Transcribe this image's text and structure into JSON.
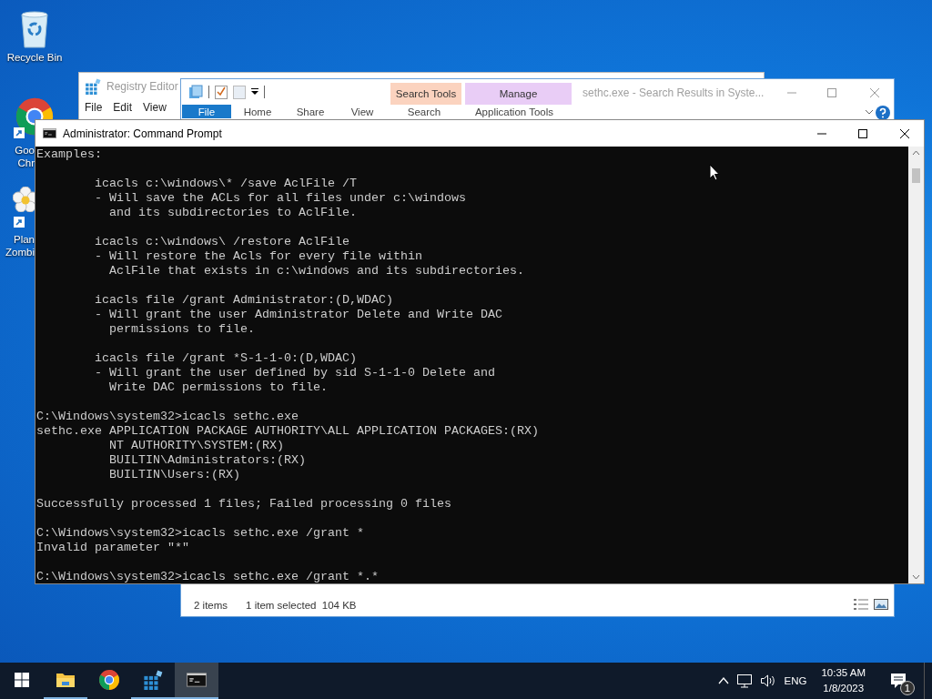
{
  "desktop_icons": [
    {
      "kind": "recycle-bin",
      "shortcut": false,
      "lines": [
        "Recycle Bin"
      ]
    },
    {
      "kind": "browser",
      "shortcut": true,
      "lines": [
        "Goo",
        "Chr"
      ]
    },
    {
      "kind": "flower",
      "shortcut": true,
      "lines": [
        "Plan",
        "Zombi"
      ]
    }
  ],
  "registry_editor": {
    "title": "Registry Editor",
    "menu": [
      "File",
      "Edit",
      "View"
    ]
  },
  "explorer": {
    "title": "sethc.exe - Search Results in Syste...",
    "context_groups": [
      {
        "label": "Search Tools",
        "color": "#fbd3bf"
      },
      {
        "label": "Manage",
        "color": "#e9cdf6"
      }
    ],
    "ribbon_tabs": [
      {
        "label": "File",
        "selected": true
      },
      {
        "label": "Home",
        "selected": false
      },
      {
        "label": "Share",
        "selected": false
      },
      {
        "label": "View",
        "selected": false
      },
      {
        "label": "Search",
        "selected": false
      },
      {
        "label": "Application Tools",
        "selected": false
      }
    ],
    "status": [
      "2 items",
      "1 item selected  104 KB"
    ]
  },
  "command_prompt": {
    "title": "Administrator: Command Prompt",
    "paragraphs": [
      [
        "Examples:"
      ],
      [
        "        icacls c:\\windows\\* /save AclFile /T",
        "        - Will save the ACLs for all files under c:\\windows",
        "          and its subdirectories to AclFile."
      ],
      [
        "        icacls c:\\windows\\ /restore AclFile",
        "        - Will restore the Acls for every file within",
        "          AclFile that exists in c:\\windows and its subdirectories."
      ],
      [
        "        icacls file /grant Administrator:(D,WDAC)",
        "        - Will grant the user Administrator Delete and Write DAC",
        "          permissions to file."
      ],
      [
        "        icacls file /grant *S-1-1-0:(D,WDAC)",
        "        - Will grant the user defined by sid S-1-1-0 Delete and",
        "          Write DAC permissions to file."
      ],
      [
        "C:\\Windows\\system32>icacls sethc.exe",
        "sethc.exe APPLICATION PACKAGE AUTHORITY\\ALL APPLICATION PACKAGES:(RX)",
        "          NT AUTHORITY\\SYSTEM:(RX)",
        "          BUILTIN\\Administrators:(RX)",
        "          BUILTIN\\Users:(RX)"
      ],
      [
        "Successfully processed 1 files; Failed processing 0 files"
      ],
      [
        "C:\\Windows\\system32>icacls sethc.exe /grant *",
        "Invalid parameter \"*\""
      ],
      [
        "C:\\Windows\\system32>icacls sethc.exe /grant *.*"
      ]
    ]
  },
  "taskbar": {
    "items": [
      {
        "kind": "start"
      },
      {
        "kind": "folder",
        "running": true,
        "selected": false
      },
      {
        "kind": "browser",
        "running": false,
        "selected": false
      },
      {
        "kind": "cubes",
        "running": true,
        "selected": false
      },
      {
        "kind": "terminal",
        "running": true,
        "selected": true
      }
    ],
    "tray": {
      "language": "ENG",
      "time": "10:35 AM",
      "date": "1/8/2023",
      "notifications": "1"
    }
  }
}
